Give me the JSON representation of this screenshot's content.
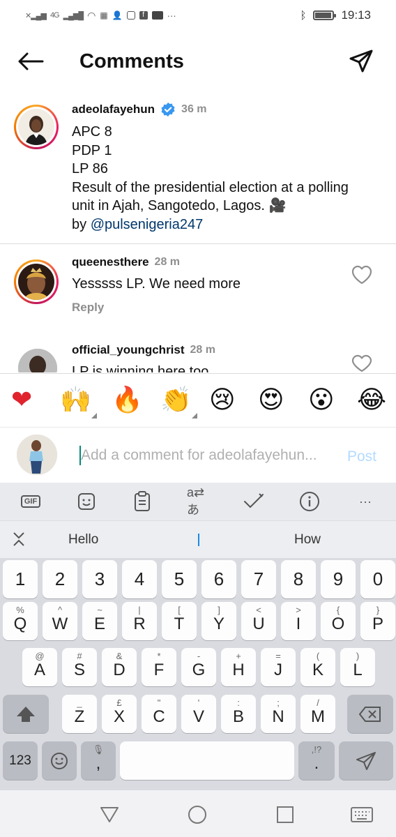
{
  "status_bar": {
    "network_label": "4G",
    "time": "19:13",
    "more": "···"
  },
  "header": {
    "title": "Comments"
  },
  "caption": {
    "username": "adeolafayehun",
    "time": "36 m",
    "lines": [
      "APC 8",
      "PDP 1",
      "LP 86",
      "Result of the presidential election at a polling unit in Ajah, Sangotedo, Lagos. 🎥"
    ],
    "by_prefix": "by ",
    "mention": "@pulsenigeria247"
  },
  "comments": [
    {
      "username": "queenesthere",
      "time": "28 m",
      "text": "Yesssss LP. We need more",
      "reply_label": "Reply"
    },
    {
      "username": "official_youngchrist",
      "time": "28 m",
      "text": "LP is winning here too"
    }
  ],
  "emoji_bar": [
    "❤",
    "🙌",
    "🔥",
    "👏",
    "😢",
    "😍",
    "😮",
    "😂"
  ],
  "comment_input": {
    "placeholder": "Add a comment for adeolafayehun...",
    "post_label": "Post"
  },
  "keyboard": {
    "toolbar": [
      "gif-icon",
      "sticker-icon",
      "clipboard-icon",
      "translate-icon",
      "handwriting-icon",
      "info-icon",
      "more-icon"
    ],
    "toolbar_gif": "GIF",
    "toolbar_more": "···",
    "suggestions": [
      "Hello",
      "How"
    ],
    "rows": {
      "numbers": [
        "1",
        "2",
        "3",
        "4",
        "5",
        "6",
        "7",
        "8",
        "9",
        "0"
      ],
      "row1": [
        {
          "k": "Q",
          "s": "%"
        },
        {
          "k": "W",
          "s": "^"
        },
        {
          "k": "E",
          "s": "~"
        },
        {
          "k": "R",
          "s": "|"
        },
        {
          "k": "T",
          "s": "["
        },
        {
          "k": "Y",
          "s": "]"
        },
        {
          "k": "U",
          "s": "<"
        },
        {
          "k": "I",
          "s": ">"
        },
        {
          "k": "O",
          "s": "{"
        },
        {
          "k": "P",
          "s": "}"
        }
      ],
      "row2": [
        {
          "k": "A",
          "s": "@"
        },
        {
          "k": "S",
          "s": "#"
        },
        {
          "k": "D",
          "s": "&"
        },
        {
          "k": "F",
          "s": "*"
        },
        {
          "k": "G",
          "s": "-"
        },
        {
          "k": "H",
          "s": "+"
        },
        {
          "k": "J",
          "s": "="
        },
        {
          "k": "K",
          "s": "("
        },
        {
          "k": "L",
          "s": ")"
        }
      ],
      "row3": [
        {
          "k": "Z",
          "s": "_"
        },
        {
          "k": "X",
          "s": "£"
        },
        {
          "k": "C",
          "s": "\""
        },
        {
          "k": "V",
          "s": "'"
        },
        {
          "k": "B",
          "s": ":"
        },
        {
          "k": "N",
          "s": ";"
        },
        {
          "k": "M",
          "s": "/"
        }
      ]
    },
    "sym_label": "123",
    "comma": ",",
    "period": ".",
    "period_sub": ",!?"
  },
  "colors": {
    "verified": "#3897f0",
    "link": "#00376b",
    "post_disabled": "#b3dbff",
    "cursor": "#00897b"
  }
}
